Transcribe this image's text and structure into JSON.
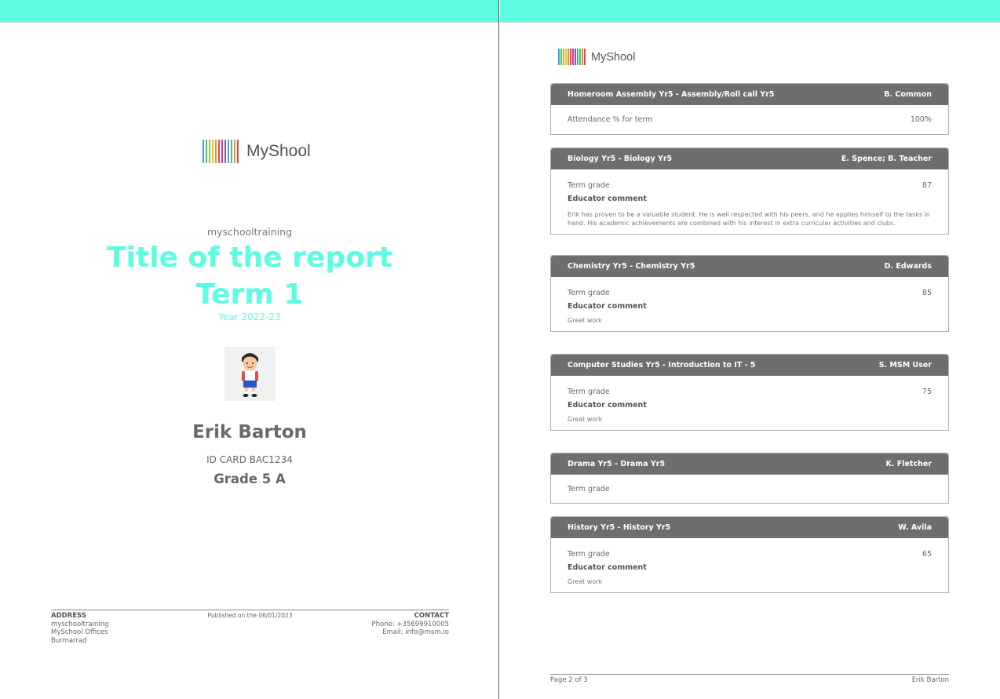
{
  "brand": {
    "logo_text": "MyShool",
    "accent_color": "#5cfde0",
    "header_color": "#6e6e6e",
    "logo_bar_colors": [
      "#3aa3d9",
      "#5bbf5b",
      "#a3c940",
      "#f3c33f",
      "#ef8d32",
      "#e0483f",
      "#c83a8c",
      "#7a5db0",
      "#3aa3d9",
      "#5bbf5b",
      "#ef8d32",
      "#e0483f"
    ]
  },
  "cover": {
    "school_name": "myschooltraining",
    "title_line1": "Title of the report",
    "title_line2": "Term 1",
    "year": "Year 2022-23",
    "student_name": "Erik Barton",
    "id_card": "ID CARD BAC1234",
    "grade": "Grade 5 A",
    "footer": {
      "address_label": "ADDRESS",
      "address_line1": "myschooltraining",
      "address_line2": "MySchool Offices",
      "address_line3": "Burmarrad",
      "published": "Published on the 06/01/2023",
      "contact_label": "CONTACT",
      "phone": "Phone: +35699910005",
      "email": "Email: info@msm.io"
    }
  },
  "subjects": [
    {
      "name": "Homeroom Assembly Yr5 - Assembly/Roll call Yr5",
      "teacher": "B. Common",
      "row_label": "Attendance % for term",
      "row_value": "100%"
    },
    {
      "name": "Biology Yr5 - Biology Yr5",
      "teacher": "E. Spence; B. Teacher",
      "row_label": "Term grade",
      "row_value": "87",
      "comment_label": "Educator comment",
      "comment": "Erik has proven to be a valuable student. He is well respected with his peers, and he applies himself to the tasks in hand. His academic achievements are combined with his interest in extra curricular activities and clubs."
    },
    {
      "name": "Chemistry Yr5 - Chemistry Yr5",
      "teacher": "D. Edwards",
      "row_label": "Term grade",
      "row_value": "85",
      "comment_label": "Educator comment",
      "comment": "Great work"
    },
    {
      "name": "Computer Studies Yr5 - Introduction to IT - 5",
      "teacher": "S. MSM User",
      "row_label": "Term grade",
      "row_value": "75",
      "comment_label": "Educator comment",
      "comment": "Great work"
    },
    {
      "name": "Drama Yr5 - Drama Yr5",
      "teacher": "K. Fletcher",
      "row_label": "Term grade",
      "row_value": ""
    },
    {
      "name": "History Yr5 - History Yr5",
      "teacher": "W. Avila",
      "row_label": "Term grade",
      "row_value": "65",
      "comment_label": "Educator comment",
      "comment": "Great work"
    }
  ],
  "right_footer": {
    "page": "Page 2 of 3",
    "student": "Erik Barton"
  }
}
